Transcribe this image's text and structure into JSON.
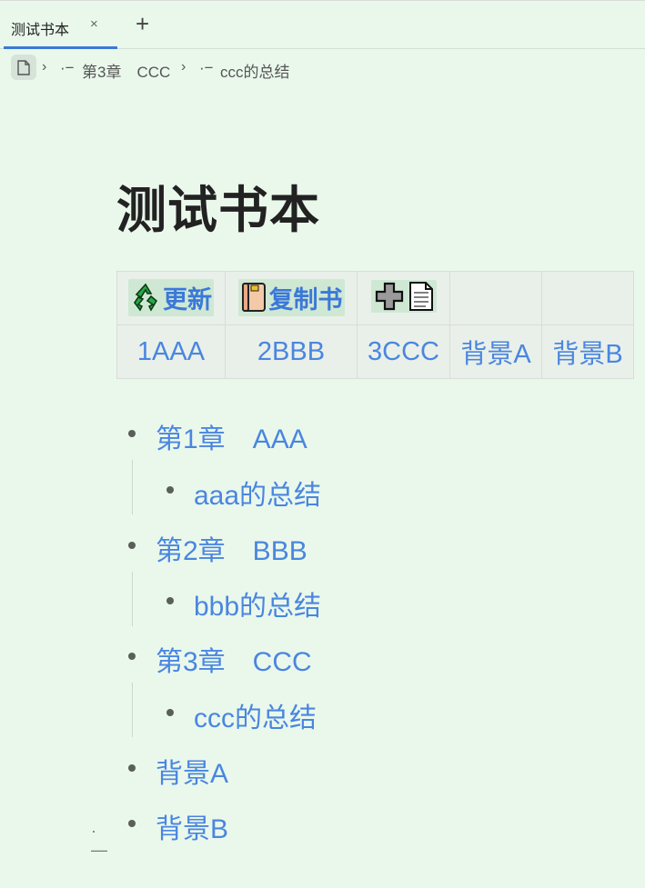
{
  "tab": {
    "title": "测试书本",
    "close": "×",
    "add": "+"
  },
  "breadcrumb": {
    "items": [
      {
        "prefix": "·−",
        "label": "第3章　CCC"
      },
      {
        "prefix": "·−",
        "label": "ccc的总结"
      }
    ]
  },
  "page_title": "测试书本",
  "toolbar": {
    "update_label": "更新",
    "copy_label": "复制书"
  },
  "table_links": [
    "1AAA",
    "2BBB",
    "3CCC",
    "背景A",
    "背景B"
  ],
  "outline": [
    {
      "label": "第1章　AAA",
      "children": [
        "aaa的总结"
      ]
    },
    {
      "label": "第2章　BBB",
      "children": [
        "bbb的总结"
      ]
    },
    {
      "label": "第3章　CCC",
      "children": [
        "ccc的总结"
      ]
    },
    {
      "label": "背景A",
      "children": []
    },
    {
      "label": "背景B",
      "children": []
    }
  ],
  "colors": {
    "background": "#eaf8ec",
    "link": "#4a86e0",
    "tab_accent": "#3b78d8"
  },
  "icons": [
    "doc-icon",
    "chevron-right-icon",
    "recycle-icon",
    "book-icon",
    "plus-icon",
    "page-icon"
  ]
}
